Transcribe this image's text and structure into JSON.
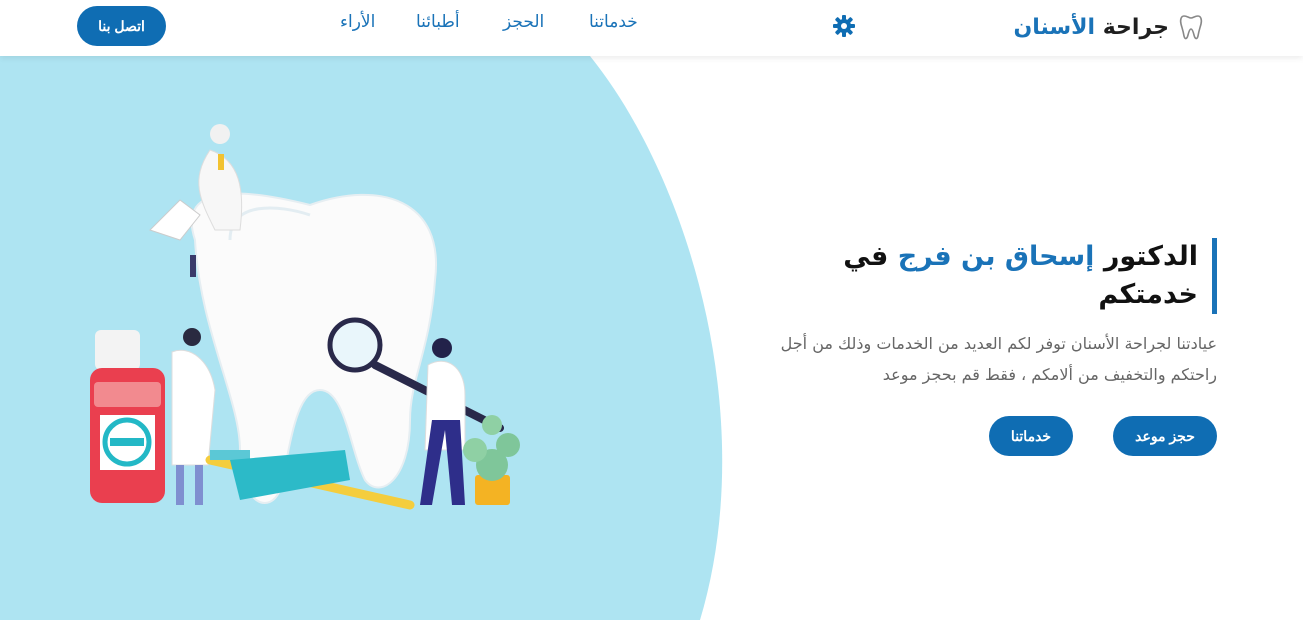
{
  "header": {
    "brand_prefix": "جراحة",
    "brand_highlight": "الأسنان",
    "nav": [
      "خدماتنا",
      "الحجز",
      "أطبائنا",
      "الأراء"
    ],
    "contact_label": "اتصل بنا"
  },
  "hero": {
    "headline_start": "الدكتور",
    "headline_name": "إسحاق بن فرج",
    "headline_end": "في خدمتكم",
    "description": "عيادتنا لجراحة الأسنان توفر لكم العديد من الخدمات وذلك من أجل راحتكم والتخفيف من ألامكم ، فقط قم بحجز موعد",
    "primary_button": "حجز موعد",
    "secondary_button": "خدماتنا"
  },
  "colors": {
    "accent": "#1a73b8",
    "hero_bg": "#aee4f2"
  },
  "icons": {
    "brand": "tooth-icon",
    "settings": "gear-icon"
  }
}
